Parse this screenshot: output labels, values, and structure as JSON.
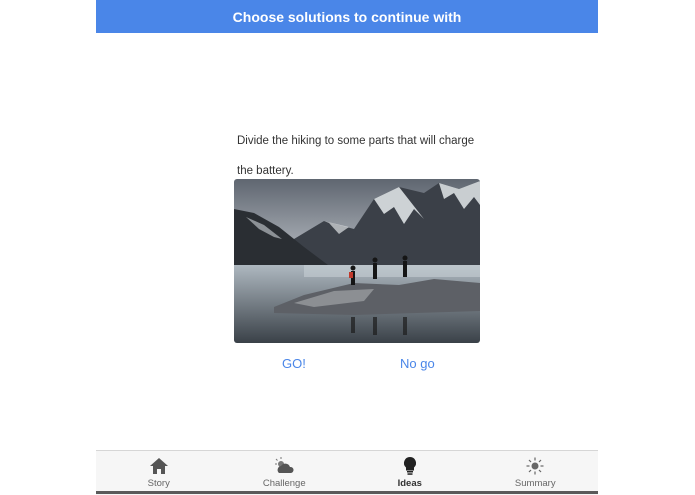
{
  "header": {
    "title": "Choose solutions to continue with"
  },
  "content": {
    "description": "Divide the hiking to some parts that will charge the battery.",
    "photo_alt": "Hikers walking on rocks beside a mountain lake"
  },
  "actions": {
    "go_label": "GO!",
    "nogo_label": "No go"
  },
  "tabs": [
    {
      "label": "Story",
      "icon": "house-icon"
    },
    {
      "label": "Challenge",
      "icon": "cloud-sun-icon"
    },
    {
      "label": "Ideas",
      "icon": "lightbulb-icon",
      "active": true
    },
    {
      "label": "Summary",
      "icon": "sun-icon"
    }
  ],
  "colors": {
    "accent": "#4a86e8",
    "tab_bg": "#f6f6f6"
  }
}
